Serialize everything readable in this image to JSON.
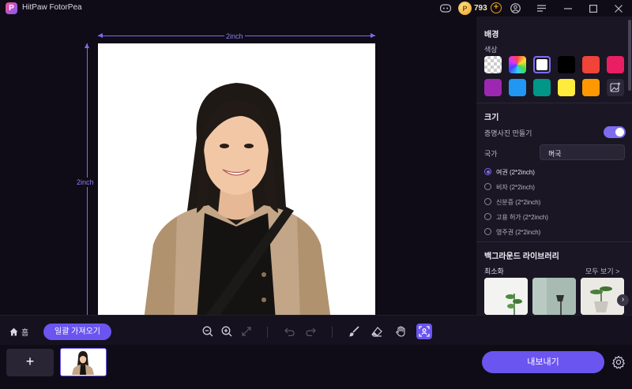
{
  "app": {
    "title": "HitPaw FotorPea",
    "logo_letter": "P"
  },
  "titlebar": {
    "credits": "793",
    "coin_symbol": "P"
  },
  "canvas": {
    "width_label": "2inch",
    "height_label": "2inch"
  },
  "panel": {
    "background_title": "배경",
    "color_label": "색상",
    "swatch_colors": [
      "#ffffff",
      "#000000",
      "#f0433a",
      "#e91e63",
      "#9c27b0",
      "#2196f3",
      "#009688",
      "#ffeb3b",
      "#ff9800"
    ],
    "size_title": "크기",
    "id_photo_label": "증명사진 만들기",
    "country_label": "국가",
    "country_value": "미국",
    "options": [
      "여권 (2*2inch)",
      "비자 (2*2inch)",
      "신분증 (2*2inch)",
      "고용 허가 (2*2inch)",
      "영주권 (2*2inch)"
    ],
    "selected_option": 0,
    "library_title": "백그라운드 라이브러리",
    "library_category": "최소화",
    "view_all": "모두 보기 >"
  },
  "toolbar": {
    "home_label": "홈",
    "batch_import": "일괄 가져오기"
  },
  "bottom": {
    "add_symbol": "+",
    "export_label": "내보내기"
  }
}
